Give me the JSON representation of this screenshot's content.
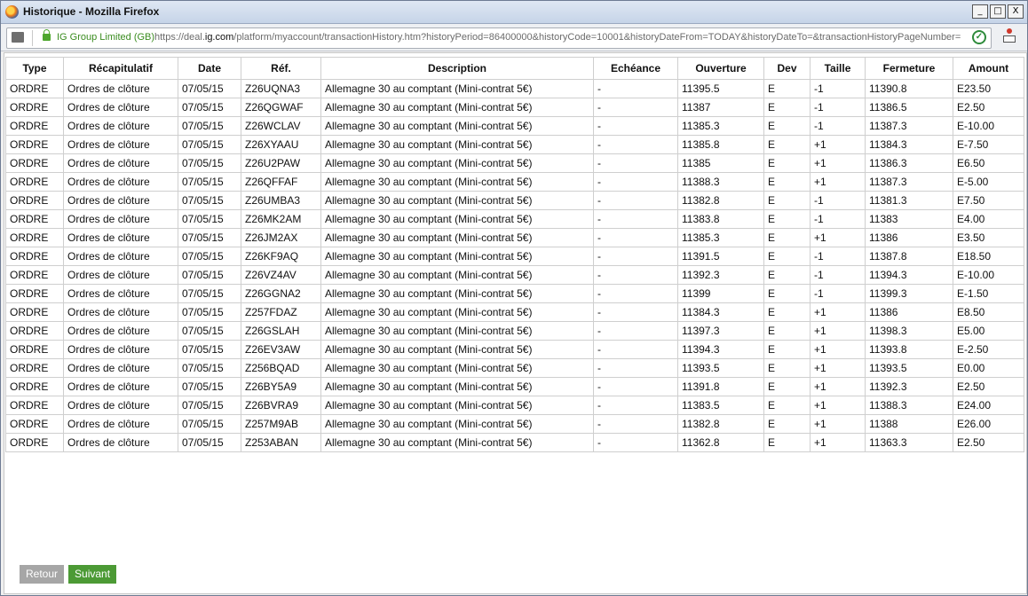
{
  "window": {
    "title": "Historique - Mozilla Firefox",
    "controls": [
      "_",
      "□",
      "X"
    ]
  },
  "urlbar": {
    "site_identity": "IG Group Limited (GB)",
    "url_prefix": "https://deal.",
    "url_domain": "ig.com",
    "url_rest": "/platform/myaccount/transactionHistory.htm?historyPeriod=86400000&historyCode=10001&historyDateFrom=TODAY&historyDateTo=&transactionHistoryPageNumber="
  },
  "table": {
    "columns": [
      "Type",
      "Récapitulatif",
      "Date",
      "Réf.",
      "Description",
      "Echéance",
      "Ouverture",
      "Dev",
      "Taille",
      "Fermeture",
      "Amount"
    ],
    "rows": [
      [
        "ORDRE",
        "Ordres de clôture",
        "07/05/15",
        "Z26UQNA3",
        "Allemagne 30 au comptant (Mini-contrat 5€)",
        "-",
        "11395.5",
        "E",
        "-1",
        "11390.8",
        "E23.50"
      ],
      [
        "ORDRE",
        "Ordres de clôture",
        "07/05/15",
        "Z26QGWAF",
        "Allemagne 30 au comptant (Mini-contrat 5€)",
        "-",
        "11387",
        "E",
        "-1",
        "11386.5",
        "E2.50"
      ],
      [
        "ORDRE",
        "Ordres de clôture",
        "07/05/15",
        "Z26WCLAV",
        "Allemagne 30 au comptant (Mini-contrat 5€)",
        "-",
        "11385.3",
        "E",
        "-1",
        "11387.3",
        "E-10.00"
      ],
      [
        "ORDRE",
        "Ordres de clôture",
        "07/05/15",
        "Z26XYAAU",
        "Allemagne 30 au comptant (Mini-contrat 5€)",
        "-",
        "11385.8",
        "E",
        "+1",
        "11384.3",
        "E-7.50"
      ],
      [
        "ORDRE",
        "Ordres de clôture",
        "07/05/15",
        "Z26U2PAW",
        "Allemagne 30 au comptant (Mini-contrat 5€)",
        "-",
        "11385",
        "E",
        "+1",
        "11386.3",
        "E6.50"
      ],
      [
        "ORDRE",
        "Ordres de clôture",
        "07/05/15",
        "Z26QFFAF",
        "Allemagne 30 au comptant (Mini-contrat 5€)",
        "-",
        "11388.3",
        "E",
        "+1",
        "11387.3",
        "E-5.00"
      ],
      [
        "ORDRE",
        "Ordres de clôture",
        "07/05/15",
        "Z26UMBA3",
        "Allemagne 30 au comptant (Mini-contrat 5€)",
        "-",
        "11382.8",
        "E",
        "-1",
        "11381.3",
        "E7.50"
      ],
      [
        "ORDRE",
        "Ordres de clôture",
        "07/05/15",
        "Z26MK2AM",
        "Allemagne 30 au comptant (Mini-contrat 5€)",
        "-",
        "11383.8",
        "E",
        "-1",
        "11383",
        "E4.00"
      ],
      [
        "ORDRE",
        "Ordres de clôture",
        "07/05/15",
        "Z26JM2AX",
        "Allemagne 30 au comptant (Mini-contrat 5€)",
        "-",
        "11385.3",
        "E",
        "+1",
        "11386",
        "E3.50"
      ],
      [
        "ORDRE",
        "Ordres de clôture",
        "07/05/15",
        "Z26KF9AQ",
        "Allemagne 30 au comptant (Mini-contrat 5€)",
        "-",
        "11391.5",
        "E",
        "-1",
        "11387.8",
        "E18.50"
      ],
      [
        "ORDRE",
        "Ordres de clôture",
        "07/05/15",
        "Z26VZ4AV",
        "Allemagne 30 au comptant (Mini-contrat 5€)",
        "-",
        "11392.3",
        "E",
        "-1",
        "11394.3",
        "E-10.00"
      ],
      [
        "ORDRE",
        "Ordres de clôture",
        "07/05/15",
        "Z26GGNA2",
        "Allemagne 30 au comptant (Mini-contrat 5€)",
        "-",
        "11399",
        "E",
        "-1",
        "11399.3",
        "E-1.50"
      ],
      [
        "ORDRE",
        "Ordres de clôture",
        "07/05/15",
        "Z257FDAZ",
        "Allemagne 30 au comptant (Mini-contrat 5€)",
        "-",
        "11384.3",
        "E",
        "+1",
        "11386",
        "E8.50"
      ],
      [
        "ORDRE",
        "Ordres de clôture",
        "07/05/15",
        "Z26GSLAH",
        "Allemagne 30 au comptant (Mini-contrat 5€)",
        "-",
        "11397.3",
        "E",
        "+1",
        "11398.3",
        "E5.00"
      ],
      [
        "ORDRE",
        "Ordres de clôture",
        "07/05/15",
        "Z26EV3AW",
        "Allemagne 30 au comptant (Mini-contrat 5€)",
        "-",
        "11394.3",
        "E",
        "+1",
        "11393.8",
        "E-2.50"
      ],
      [
        "ORDRE",
        "Ordres de clôture",
        "07/05/15",
        "Z256BQAD",
        "Allemagne 30 au comptant (Mini-contrat 5€)",
        "-",
        "11393.5",
        "E",
        "+1",
        "11393.5",
        "E0.00"
      ],
      [
        "ORDRE",
        "Ordres de clôture",
        "07/05/15",
        "Z26BY5A9",
        "Allemagne 30 au comptant (Mini-contrat 5€)",
        "-",
        "11391.8",
        "E",
        "+1",
        "11392.3",
        "E2.50"
      ],
      [
        "ORDRE",
        "Ordres de clôture",
        "07/05/15",
        "Z26BVRA9",
        "Allemagne 30 au comptant (Mini-contrat 5€)",
        "-",
        "11383.5",
        "E",
        "+1",
        "11388.3",
        "E24.00"
      ],
      [
        "ORDRE",
        "Ordres de clôture",
        "07/05/15",
        "Z257M9AB",
        "Allemagne 30 au comptant (Mini-contrat 5€)",
        "-",
        "11382.8",
        "E",
        "+1",
        "11388",
        "E26.00"
      ],
      [
        "ORDRE",
        "Ordres de clôture",
        "07/05/15",
        "Z253ABAN",
        "Allemagne 30 au comptant (Mini-contrat 5€)",
        "-",
        "11362.8",
        "E",
        "+1",
        "11363.3",
        "E2.50"
      ]
    ]
  },
  "pager": {
    "prev_label": "Retour",
    "next_label": "Suivant"
  },
  "colors": {
    "next_button": "#4c9a35",
    "prev_button": "#a6a6a6",
    "secure_green": "#3a8c1f"
  }
}
